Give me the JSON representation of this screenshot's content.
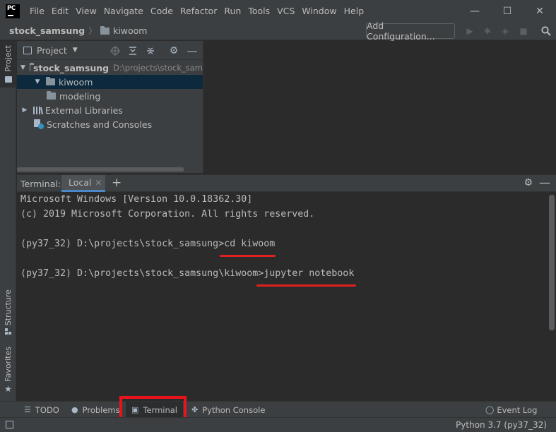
{
  "window": {
    "menu": [
      "File",
      "Edit",
      "View",
      "Navigate",
      "Code",
      "Refactor",
      "Run",
      "Tools",
      "VCS",
      "Window",
      "Help"
    ],
    "minimize": "—",
    "maximize": "☐",
    "close": "✕"
  },
  "navbar": {
    "project": "stock_samsung",
    "folder": "kiwoom",
    "add_configuration": "Add Configuration..."
  },
  "sidebar": {
    "project_tab": "Project",
    "structure_tab": "Structure",
    "favorites_tab": "Favorites"
  },
  "project_panel": {
    "title": "Project",
    "tree": [
      {
        "label": "stock_samsung",
        "path": "D:\\projects\\stock_sam",
        "expanded": true
      },
      {
        "label": "kiwoom",
        "expanded": true,
        "selected": true
      },
      {
        "label": "modeling"
      },
      {
        "label": "External Libraries",
        "expanded": false
      },
      {
        "label": "Scratches and Consoles"
      }
    ]
  },
  "terminal": {
    "label": "Terminal:",
    "tab": "Local",
    "lines": [
      "Microsoft Windows [Version 10.0.18362.30]",
      "(c) 2019 Microsoft Corporation. All rights reserved.",
      "",
      "(py37_32) D:\\projects\\stock_samsung>cd kiwoom",
      "",
      "(py37_32) D:\\projects\\stock_samsung\\kiwoom>jupyter notebook"
    ]
  },
  "toolbar_bottom": {
    "todo": "TODO",
    "problems": "Problems",
    "terminal": "Terminal",
    "python_console": "Python Console",
    "event_log": "Event Log"
  },
  "status": {
    "interpreter": "Python 3.7 (py37_32)"
  },
  "colors": {
    "background": "#2b2b2b",
    "panel": "#3c3f41",
    "selection": "#0d293e",
    "accent_tab": "#4a88c7",
    "annotation_red": "#e02020"
  }
}
